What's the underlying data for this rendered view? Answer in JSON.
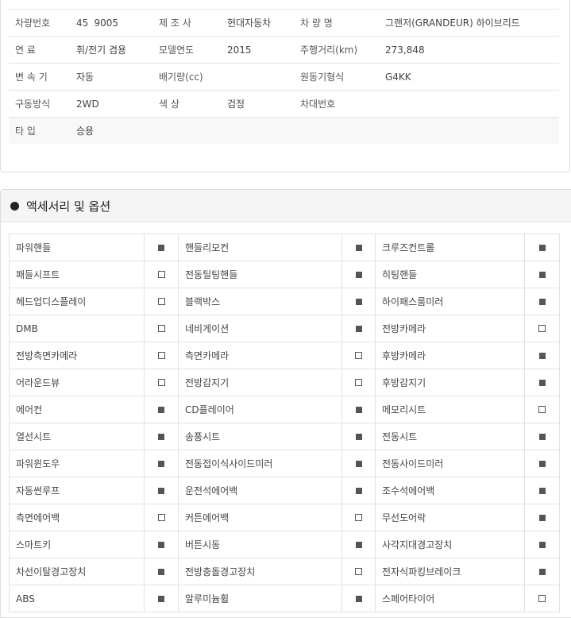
{
  "spec": {
    "rows": [
      [
        {
          "label": "차량번호",
          "value": "45   9005"
        },
        {
          "label": "제 조 사",
          "value": "현대자동차"
        },
        {
          "label": "차 량 명",
          "value": "그랜저(GRANDEUR) 하이브리드"
        }
      ],
      [
        {
          "label": "연 료",
          "value": "휘/전기 겸용"
        },
        {
          "label": "모델연도",
          "value": "2015"
        },
        {
          "label": "주행거리(km)",
          "value": "273,848"
        }
      ],
      [
        {
          "label": "변 속 기",
          "value": "자동"
        },
        {
          "label": "배기량(cc)",
          "value": ""
        },
        {
          "label": "원동기형식",
          "value": "G4KK"
        }
      ],
      [
        {
          "label": "구동방식",
          "value": "2WD"
        },
        {
          "label": "색 상",
          "value": "검정"
        },
        {
          "label": "차대번호",
          "value": ""
        }
      ],
      [
        {
          "label": "타 입",
          "value": "승용"
        },
        {
          "label": "",
          "value": ""
        },
        {
          "label": "",
          "value": ""
        }
      ]
    ]
  },
  "options": {
    "title": "액세서리 및 옵션",
    "rows": [
      [
        {
          "name": "파워핸들",
          "checked": true
        },
        {
          "name": "핸들리모컨",
          "checked": true
        },
        {
          "name": "크루즈컨트롤",
          "checked": true
        }
      ],
      [
        {
          "name": "패들시프트",
          "checked": false
        },
        {
          "name": "전동틸팅핸들",
          "checked": true
        },
        {
          "name": "히팅핸들",
          "checked": true
        }
      ],
      [
        {
          "name": "헤드업디스플레이",
          "checked": false
        },
        {
          "name": "블랙박스",
          "checked": true
        },
        {
          "name": "하이패스룸미러",
          "checked": true
        }
      ],
      [
        {
          "name": "DMB",
          "checked": false
        },
        {
          "name": "네비게이션",
          "checked": true
        },
        {
          "name": "전방카메라",
          "checked": false
        }
      ],
      [
        {
          "name": "전방측면카메라",
          "checked": false
        },
        {
          "name": "측면카메라",
          "checked": false
        },
        {
          "name": "후방카메라",
          "checked": true
        }
      ],
      [
        {
          "name": "어라운드뷰",
          "checked": false
        },
        {
          "name": "전방감지기",
          "checked": false
        },
        {
          "name": "후방감지기",
          "checked": true
        }
      ],
      [
        {
          "name": "에어컨",
          "checked": true
        },
        {
          "name": "CD플레이어",
          "checked": true
        },
        {
          "name": "메모리시트",
          "checked": false
        }
      ],
      [
        {
          "name": "열선시트",
          "checked": true
        },
        {
          "name": "송풍시트",
          "checked": true
        },
        {
          "name": "전동시트",
          "checked": true
        }
      ],
      [
        {
          "name": "파워윈도우",
          "checked": true
        },
        {
          "name": "전동접이식사이드미러",
          "checked": true
        },
        {
          "name": "전동사이드미러",
          "checked": true
        }
      ],
      [
        {
          "name": "자동썬루프",
          "checked": true
        },
        {
          "name": "운전석에어백",
          "checked": true
        },
        {
          "name": "조수석에어백",
          "checked": true
        }
      ],
      [
        {
          "name": "측면에어백",
          "checked": false
        },
        {
          "name": "커튼에어백",
          "checked": false
        },
        {
          "name": "무선도어락",
          "checked": true
        }
      ],
      [
        {
          "name": "스마트키",
          "checked": true
        },
        {
          "name": "버튼시동",
          "checked": true
        },
        {
          "name": "사각지대경고장치",
          "checked": true
        }
      ],
      [
        {
          "name": "차선이탈경고장치",
          "checked": true
        },
        {
          "name": "전방충돌경고장치",
          "checked": false
        },
        {
          "name": "전자식파킹브레이크",
          "checked": true
        }
      ],
      [
        {
          "name": "ABS",
          "checked": true
        },
        {
          "name": "알루미늄휠",
          "checked": true
        },
        {
          "name": "스페어타이어",
          "checked": false
        }
      ]
    ]
  }
}
